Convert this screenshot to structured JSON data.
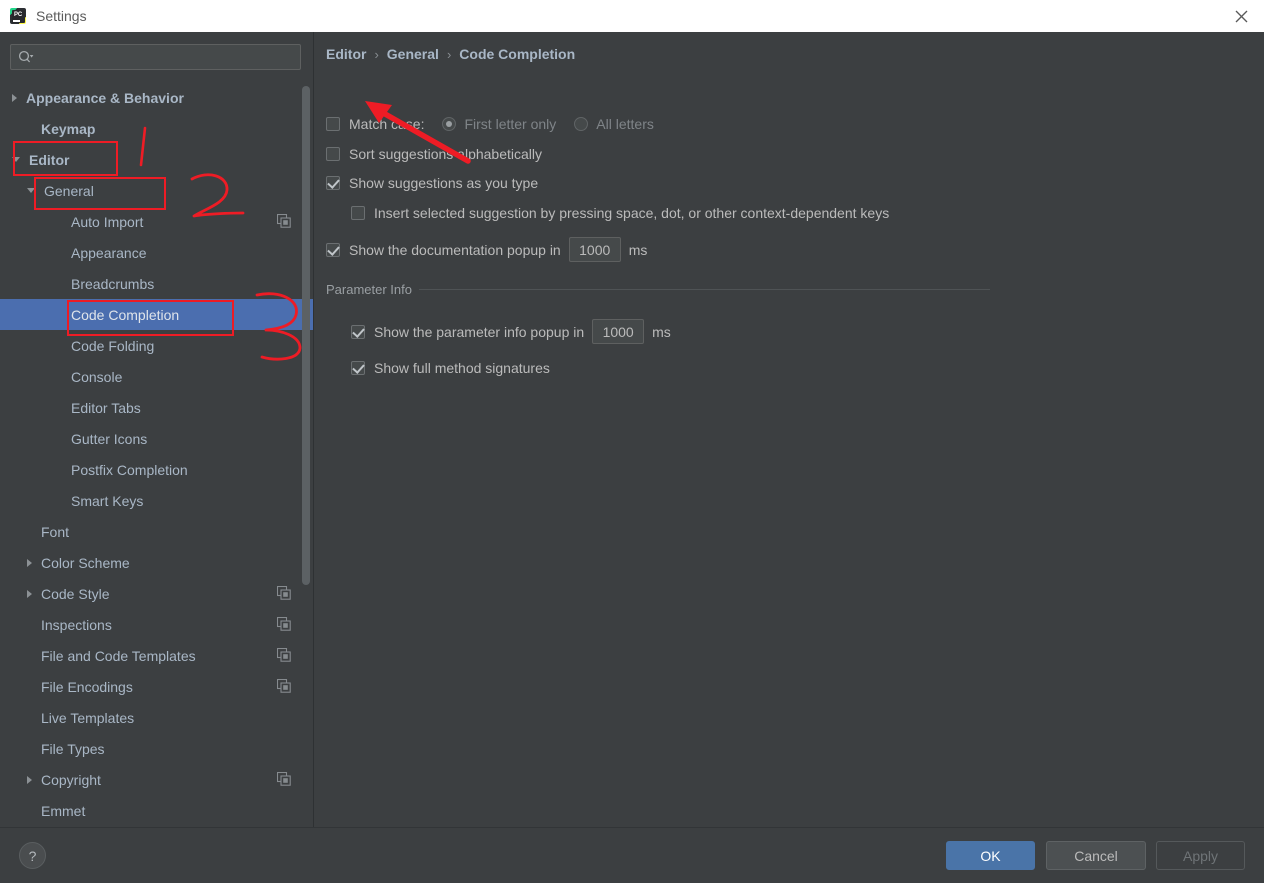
{
  "window": {
    "title": "Settings",
    "app_icon": "pycharm-icon",
    "icon_text": "PC",
    "close_icon": "close-icon"
  },
  "sidebar": {
    "search": {
      "placeholder": "",
      "value": "",
      "icon": "search-icon"
    },
    "tree": [
      {
        "label": "Appearance & Behavior",
        "indent": 0,
        "arrow": "right",
        "bold": true,
        "copy": false,
        "selected": false
      },
      {
        "label": "Keymap",
        "indent": 1,
        "arrow": "none",
        "bold": true,
        "copy": false,
        "selected": false
      },
      {
        "label": "Editor",
        "indent": 0,
        "arrow": "down",
        "bold": true,
        "copy": false,
        "selected": false
      },
      {
        "label": "General",
        "indent": 1,
        "arrow": "down",
        "bold": false,
        "copy": false,
        "selected": false
      },
      {
        "label": "Auto Import",
        "indent": 2,
        "arrow": "none",
        "bold": false,
        "copy": true,
        "selected": false
      },
      {
        "label": "Appearance",
        "indent": 2,
        "arrow": "none",
        "bold": false,
        "copy": false,
        "selected": false
      },
      {
        "label": "Breadcrumbs",
        "indent": 2,
        "arrow": "none",
        "bold": false,
        "copy": false,
        "selected": false
      },
      {
        "label": "Code Completion",
        "indent": 2,
        "arrow": "none",
        "bold": false,
        "copy": false,
        "selected": true
      },
      {
        "label": "Code Folding",
        "indent": 2,
        "arrow": "none",
        "bold": false,
        "copy": false,
        "selected": false
      },
      {
        "label": "Console",
        "indent": 2,
        "arrow": "none",
        "bold": false,
        "copy": false,
        "selected": false
      },
      {
        "label": "Editor Tabs",
        "indent": 2,
        "arrow": "none",
        "bold": false,
        "copy": false,
        "selected": false
      },
      {
        "label": "Gutter Icons",
        "indent": 2,
        "arrow": "none",
        "bold": false,
        "copy": false,
        "selected": false
      },
      {
        "label": "Postfix Completion",
        "indent": 2,
        "arrow": "none",
        "bold": false,
        "copy": false,
        "selected": false
      },
      {
        "label": "Smart Keys",
        "indent": 2,
        "arrow": "none",
        "bold": false,
        "copy": false,
        "selected": false
      },
      {
        "label": "Font",
        "indent": 1,
        "arrow": "none",
        "bold": false,
        "copy": false,
        "selected": false
      },
      {
        "label": "Color Scheme",
        "indent": 1,
        "arrow": "right",
        "bold": false,
        "copy": false,
        "selected": false
      },
      {
        "label": "Code Style",
        "indent": 1,
        "arrow": "right",
        "bold": false,
        "copy": true,
        "selected": false
      },
      {
        "label": "Inspections",
        "indent": 1,
        "arrow": "none",
        "bold": false,
        "copy": true,
        "selected": false
      },
      {
        "label": "File and Code Templates",
        "indent": 1,
        "arrow": "none",
        "bold": false,
        "copy": true,
        "selected": false
      },
      {
        "label": "File Encodings",
        "indent": 1,
        "arrow": "none",
        "bold": false,
        "copy": true,
        "selected": false
      },
      {
        "label": "Live Templates",
        "indent": 1,
        "arrow": "none",
        "bold": false,
        "copy": false,
        "selected": false
      },
      {
        "label": "File Types",
        "indent": 1,
        "arrow": "none",
        "bold": false,
        "copy": false,
        "selected": false
      },
      {
        "label": "Copyright",
        "indent": 1,
        "arrow": "right",
        "bold": false,
        "copy": true,
        "selected": false
      },
      {
        "label": "Emmet",
        "indent": 1,
        "arrow": "none",
        "bold": false,
        "copy": false,
        "selected": false
      }
    ]
  },
  "main": {
    "breadcrumb": {
      "level1": "Editor",
      "level2": "General",
      "level3": "Code Completion",
      "separator": "›"
    },
    "options": {
      "match_case_label": "Match case:",
      "match_case_checked": false,
      "radio_first_letter": "First letter only",
      "radio_all_letters": "All letters",
      "sort_alphabetically": "Sort suggestions alphabetically",
      "show_suggestions": "Show suggestions as you type",
      "insert_selected": "Insert selected suggestion by pressing space, dot, or other context-dependent keys",
      "doc_popup_label": "Show the documentation popup in",
      "doc_popup_value": "1000",
      "doc_popup_unit": "ms"
    },
    "parameter_info": {
      "group_title": "Parameter Info",
      "popup_label": "Show the parameter info popup in",
      "popup_value": "1000",
      "popup_unit": "ms",
      "full_signatures": "Show full method signatures"
    }
  },
  "footer": {
    "help_label": "?",
    "ok": "OK",
    "cancel": "Cancel",
    "apply": "Apply"
  },
  "annotations": {
    "accent_color": "#ee1c25",
    "marks": [
      "1",
      "2",
      "3"
    ],
    "arrow": "red-arrow-pointing-to-match-case-checkbox"
  },
  "colors": {
    "titlebar_bg": "#ffffff",
    "panel_bg": "#3c3f41",
    "selection_blue": "#4b6eaf",
    "ok_button": "#4a74a8",
    "text": "#bbbbbb",
    "annotation_red": "#ee1c25"
  }
}
